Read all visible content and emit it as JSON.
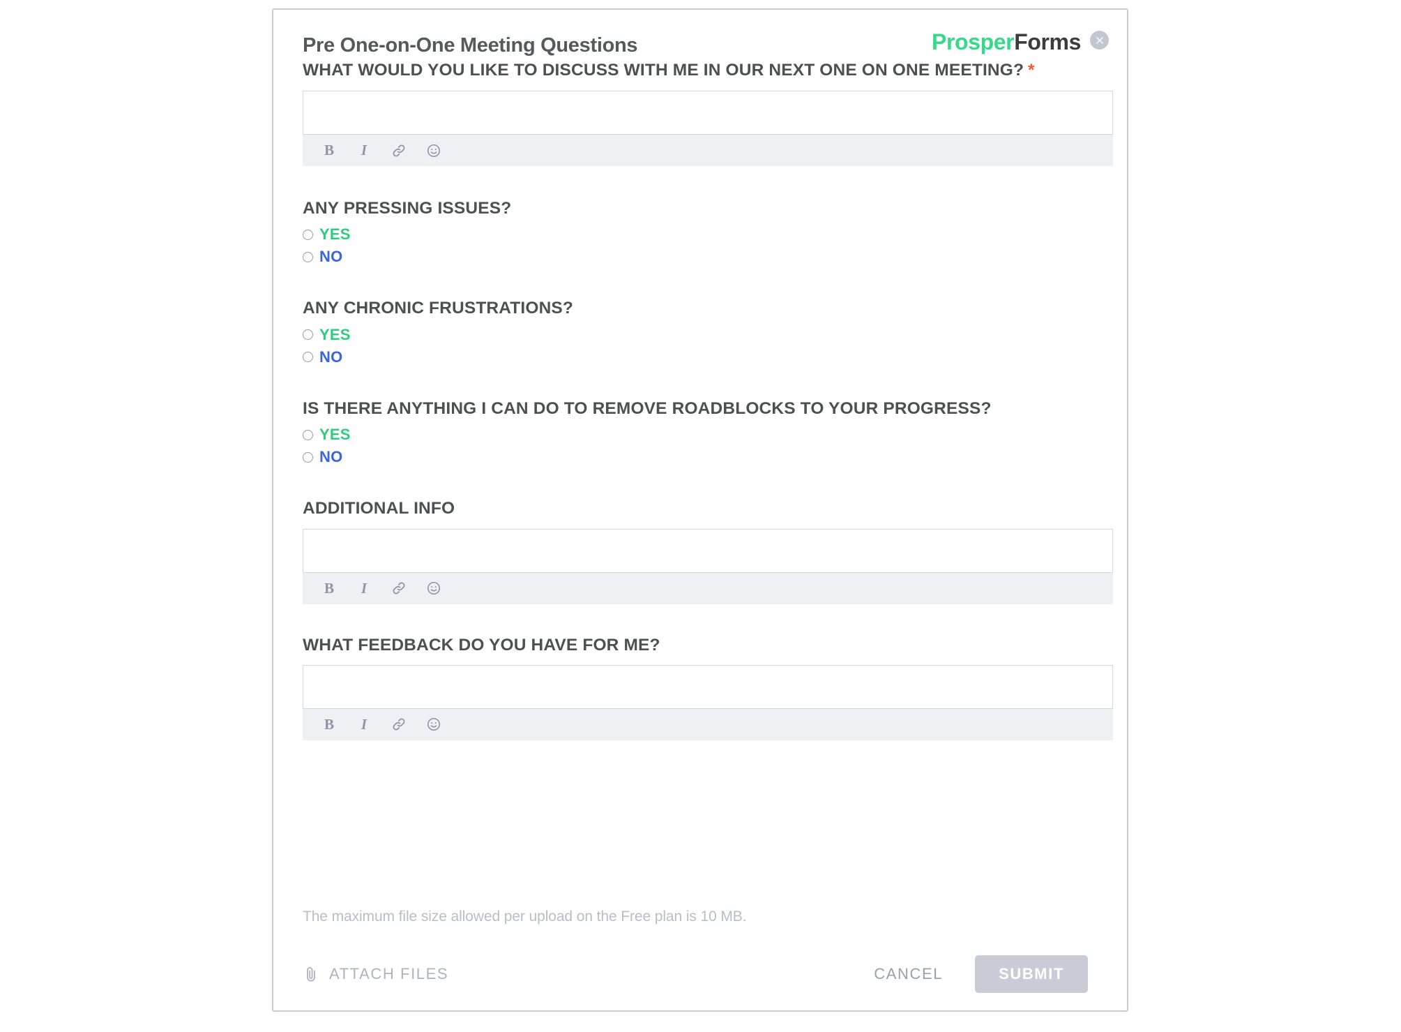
{
  "brand": {
    "part1": "Prosper",
    "part2": "Forms",
    "close_icon": "close-icon"
  },
  "form": {
    "title": "Pre One-on-One Meeting Questions",
    "required_marker": "*"
  },
  "editor_toolbar": {
    "bold": "B",
    "italic": "I",
    "link_icon": "link-icon",
    "emoji_icon": "emoji-icon"
  },
  "fields": [
    {
      "label": "WHAT WOULD YOU LIKE TO DISCUSS WITH ME IN OUR NEXT ONE ON ONE MEETING?",
      "type": "richtext",
      "required": true,
      "value": "",
      "placeholder": ""
    },
    {
      "label": "ANY PRESSING ISSUES?",
      "type": "radio",
      "required": false,
      "options": [
        {
          "label": "YES",
          "color": "#2ecc7d",
          "selected": false
        },
        {
          "label": "NO",
          "color": "#3b64e0",
          "selected": false
        }
      ]
    },
    {
      "label": "ANY CHRONIC FRUSTRATIONS?",
      "type": "radio",
      "required": false,
      "options": [
        {
          "label": "YES",
          "color": "#2ecc7d",
          "selected": false
        },
        {
          "label": "NO",
          "color": "#3b64e0",
          "selected": false
        }
      ]
    },
    {
      "label": "IS THERE ANYTHING I CAN DO TO REMOVE ROADBLOCKS TO YOUR PROGRESS?",
      "type": "radio",
      "required": false,
      "options": [
        {
          "label": "YES",
          "color": "#2ecc7d",
          "selected": false
        },
        {
          "label": "NO",
          "color": "#3b64e0",
          "selected": false
        }
      ]
    },
    {
      "label": "ADDITIONAL INFO",
      "type": "richtext",
      "required": false,
      "value": "",
      "placeholder": ""
    },
    {
      "label": "WHAT FEEDBACK DO YOU HAVE FOR ME?",
      "type": "richtext",
      "required": false,
      "value": "",
      "placeholder": ""
    }
  ],
  "footer": {
    "file_note": "The maximum file size allowed per upload on the Free plan is 10 MB.",
    "attach_label": "ATTACH FILES",
    "attach_icon": "paperclip-icon",
    "cancel_label": "CANCEL",
    "submit_label": "SUBMIT",
    "submit_disabled": true
  },
  "colors": {
    "brand_green": "#36d98a",
    "brand_dark": "#3c3c3c",
    "required_star": "#f4582a",
    "yes_green": "#2ecc7d",
    "no_blue": "#3b64e0",
    "submit_bg": "#c9ccd6",
    "card_border": "#c9ccd4",
    "toolbar_bg": "#eef0f3"
  }
}
